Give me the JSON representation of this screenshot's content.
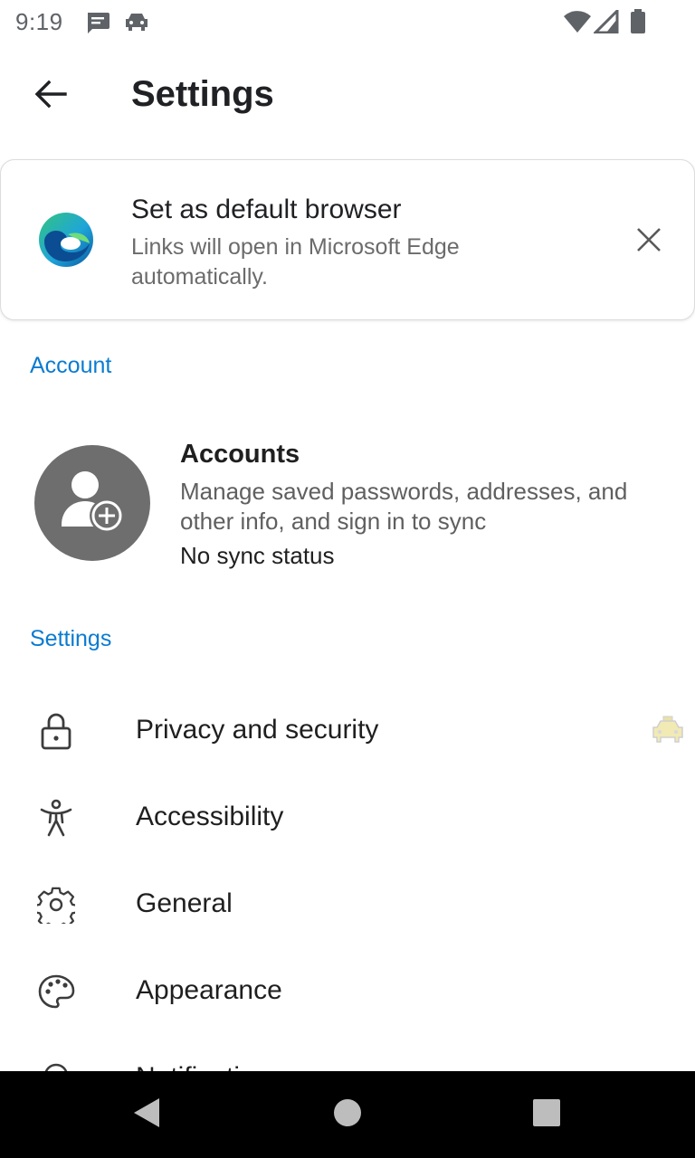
{
  "status_bar": {
    "time": "9:19",
    "icons": [
      "message-icon",
      "car-icon",
      "wifi-icon",
      "signal-icon",
      "battery-icon"
    ]
  },
  "app_bar": {
    "title": "Settings",
    "back_icon": "arrow-left-icon"
  },
  "default_browser_card": {
    "title": "Set as default browser",
    "subtitle": "Links will open in Microsoft Edge automatically.",
    "logo_icon": "edge-logo-icon",
    "close_icon": "close-icon"
  },
  "account_section": {
    "header": "Account",
    "accounts": {
      "title": "Accounts",
      "description": "Manage saved passwords, addresses, and other info, and sign in to sync",
      "status": "No sync status",
      "avatar_icon": "add-person-icon"
    }
  },
  "settings_section": {
    "header": "Settings",
    "items": [
      {
        "label": "Privacy and security",
        "icon": "lock-icon"
      },
      {
        "label": "Accessibility",
        "icon": "accessibility-icon"
      },
      {
        "label": "General",
        "icon": "gear-icon"
      },
      {
        "label": "Appearance",
        "icon": "palette-icon"
      },
      {
        "label": "Notifications",
        "icon": "bell-icon"
      }
    ]
  },
  "colors": {
    "accent": "#0a7bd1",
    "avatar_bg": "#6e6e6e",
    "nav_bg": "#000000"
  }
}
